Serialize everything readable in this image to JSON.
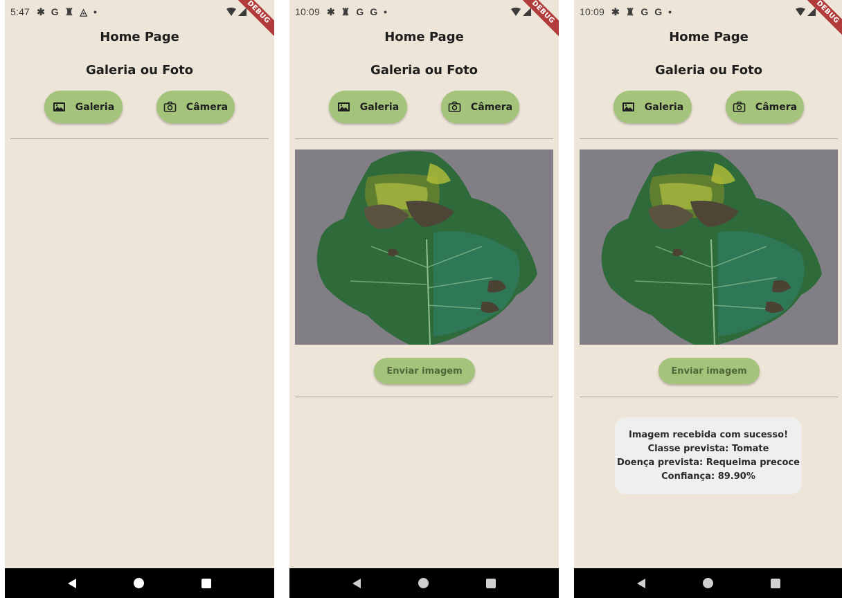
{
  "theme": {
    "background": "#ede5d7",
    "button": "#a3c47a",
    "result_box": "#f0efef",
    "nav_bar": "#000000",
    "debug_ribbon": "#b23b3b"
  },
  "debug_banner": "DEBUG",
  "screens": [
    {
      "status": {
        "time": "5:47",
        "icons": [
          "gear-icon",
          "google-icon",
          "key-icon",
          "drive-icon",
          "dot-icon"
        ]
      },
      "app_title": "Home Page",
      "section_title": "Galeria ou Foto",
      "buttons": {
        "gallery": "Galeria",
        "camera": "Câmera"
      }
    },
    {
      "status": {
        "time": "10:09",
        "icons": [
          "gear-icon",
          "key-icon",
          "google-icon",
          "google-icon",
          "dot-icon"
        ]
      },
      "app_title": "Home Page",
      "section_title": "Galeria ou Foto",
      "buttons": {
        "gallery": "Galeria",
        "camera": "Câmera"
      },
      "send_button": "Enviar imagem"
    },
    {
      "status": {
        "time": "10:09",
        "icons": [
          "gear-icon",
          "key-icon",
          "google-icon",
          "google-icon",
          "dot-icon"
        ]
      },
      "app_title": "Home Page",
      "section_title": "Galeria ou Foto",
      "buttons": {
        "gallery": "Galeria",
        "camera": "Câmera"
      },
      "send_button": "Enviar imagem",
      "result": {
        "line1": "Imagem recebida com sucesso!",
        "line2": "Classe prevista: Tomate",
        "line3": "Doença prevista: Requeima precoce",
        "line4": "Confiança: 89.90%"
      }
    }
  ]
}
